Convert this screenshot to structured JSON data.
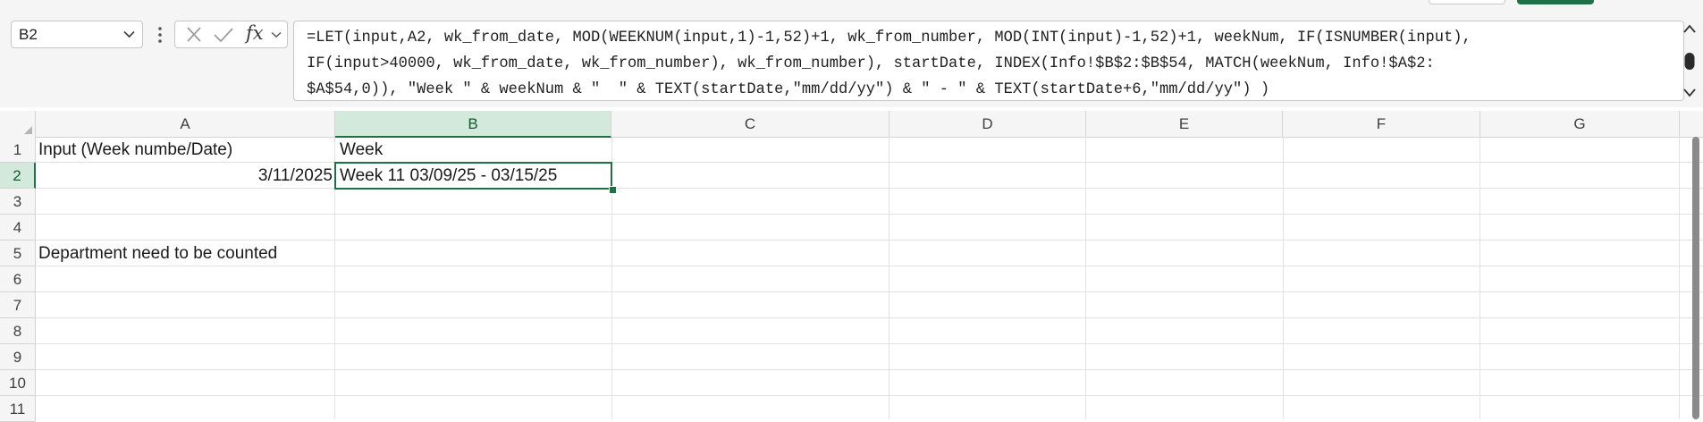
{
  "name_box": {
    "value": "B2"
  },
  "formula_bar": {
    "fx_label": "fx",
    "lines": [
      "=LET(input,A2, wk_from_date, MOD(WEEKNUM(input,1)-1,52)+1, wk_from_number, MOD(INT(input)-1,52)+1, weekNum, IF(ISNUMBER(input),",
      "IF(input>40000, wk_from_date, wk_from_number), wk_from_number), startDate, INDEX(Info!$B$2:$B$54, MATCH(weekNum, Info!$A$2:",
      "$A$54,0)), \"Week \" & weekNum & \"  \" & TEXT(startDate,\"mm/dd/yy\") & \" - \" & TEXT(startDate+6,\"mm/dd/yy\") )"
    ]
  },
  "columns": [
    "A",
    "B",
    "C",
    "D",
    "E",
    "F",
    "G"
  ],
  "active_column": "B",
  "rows": [
    "1",
    "2",
    "3",
    "4",
    "5",
    "6",
    "7",
    "8",
    "9",
    "10",
    "11"
  ],
  "active_row": "2",
  "cells": {
    "A1": "Input (Week numbe/Date)",
    "B1": "Week",
    "A2": "3/11/2025",
    "B2": "Week 11  03/09/25 - 03/15/25",
    "A5": "Department need to be counted"
  },
  "colors": {
    "accent": "#1e7145",
    "header_active_bg": "#d3e9dc",
    "grid_line": "#e1e1e1"
  }
}
